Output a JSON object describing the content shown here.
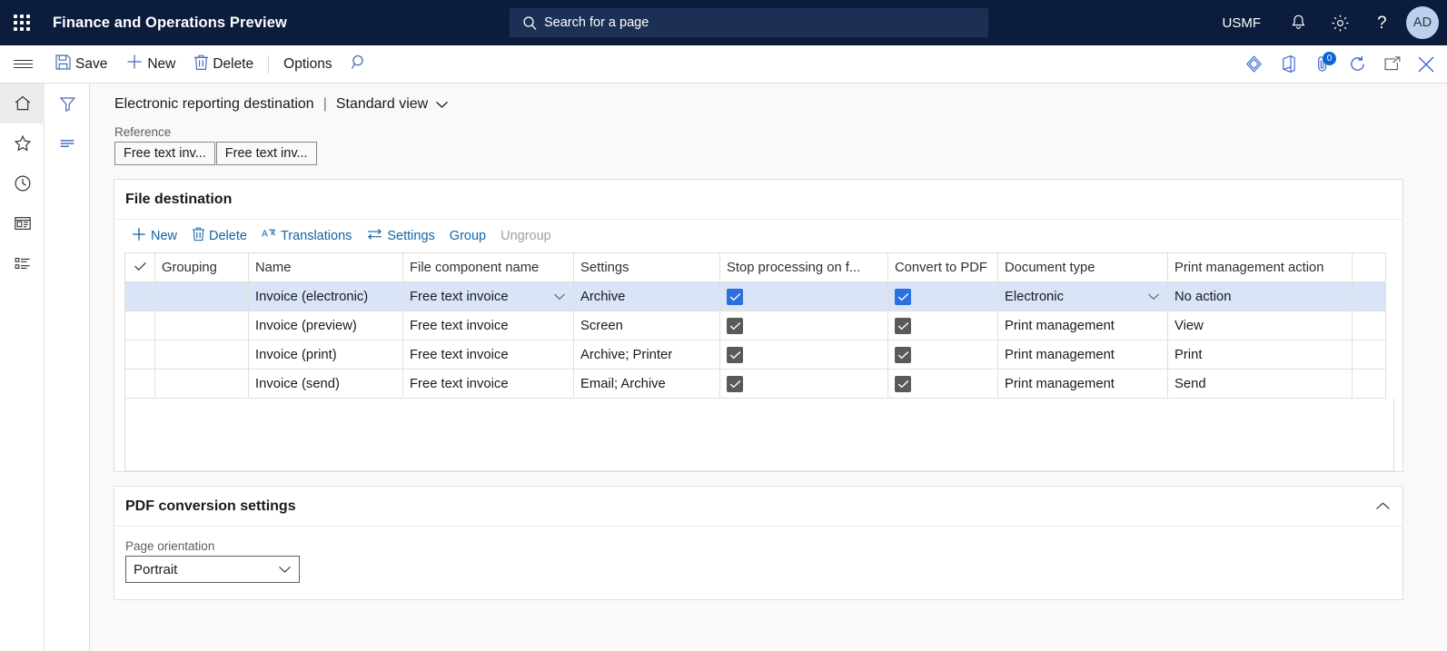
{
  "topbar": {
    "app_title": "Finance and Operations Preview",
    "search_placeholder": "Search for a page",
    "company": "USMF",
    "avatar_initials": "AD",
    "icons": [
      "waffle-icon",
      "search-icon",
      "notification-bell-icon",
      "settings-gear-icon",
      "help-question-icon"
    ]
  },
  "actionpane": {
    "save_label": "Save",
    "new_label": "New",
    "delete_label": "Delete",
    "options_label": "Options",
    "right_icons": [
      "power-apps-icon",
      "office-icon",
      "attachments-icon",
      "refresh-icon",
      "open-in-new-window-icon",
      "close-icon"
    ],
    "attachment_count": "0"
  },
  "navrail": {
    "items": [
      {
        "name": "home",
        "icon": "home-icon"
      },
      {
        "name": "favorites",
        "icon": "star-icon"
      },
      {
        "name": "recent",
        "icon": "clock-icon"
      },
      {
        "name": "workspaces",
        "icon": "workspace-icon"
      },
      {
        "name": "modules",
        "icon": "list-icon"
      }
    ]
  },
  "filterrail": {
    "items": [
      {
        "name": "filter",
        "icon": "filter-funnel-icon"
      },
      {
        "name": "show-list",
        "icon": "lines-icon"
      }
    ]
  },
  "page": {
    "breadcrumb_title": "Electronic reporting destination",
    "breadcrumb_separator": "|",
    "view_label": "Standard view",
    "reference_label": "Reference",
    "reference_chips": [
      "Free text inv...",
      "Free text inv..."
    ]
  },
  "file_destination": {
    "panel_title": "File destination",
    "toolbar": {
      "new_label": "New",
      "delete_label": "Delete",
      "translations_label": "Translations",
      "settings_label": "Settings",
      "group_label": "Group",
      "ungroup_label": "Ungroup"
    },
    "columns": [
      "Grouping",
      "Name",
      "File component name",
      "Settings",
      "Stop processing on f...",
      "Convert to PDF",
      "Document type",
      "Print management action"
    ],
    "rows": [
      {
        "selected": true,
        "grouping": "",
        "name": "Invoice (electronic)",
        "file_component_name": "Free text invoice",
        "settings": "Archive",
        "stop_processing": true,
        "convert_to_pdf": true,
        "document_type": "Electronic",
        "print_management_action": "No action"
      },
      {
        "selected": false,
        "grouping": "",
        "name": "Invoice (preview)",
        "file_component_name": "Free text invoice",
        "settings": "Screen",
        "stop_processing": true,
        "convert_to_pdf": true,
        "document_type": "Print management",
        "print_management_action": "View"
      },
      {
        "selected": false,
        "grouping": "",
        "name": "Invoice (print)",
        "file_component_name": "Free text invoice",
        "settings": "Archive; Printer",
        "stop_processing": true,
        "convert_to_pdf": true,
        "document_type": "Print management",
        "print_management_action": "Print"
      },
      {
        "selected": false,
        "grouping": "",
        "name": "Invoice (send)",
        "file_component_name": "Free text invoice",
        "settings": "Email; Archive",
        "stop_processing": true,
        "convert_to_pdf": true,
        "document_type": "Print management",
        "print_management_action": "Send"
      }
    ]
  },
  "pdf_settings": {
    "panel_title": "PDF conversion settings",
    "page_orientation_label": "Page orientation",
    "page_orientation_value": "Portrait"
  },
  "colors": {
    "nav_background": "#0b1c3d",
    "accent_blue": "#1264a3",
    "selected_row": "#d9e4f7",
    "checkbox_on": "#2b70e0",
    "checkbox_off": "#5a5a58",
    "content_background": "#faf9f8"
  }
}
